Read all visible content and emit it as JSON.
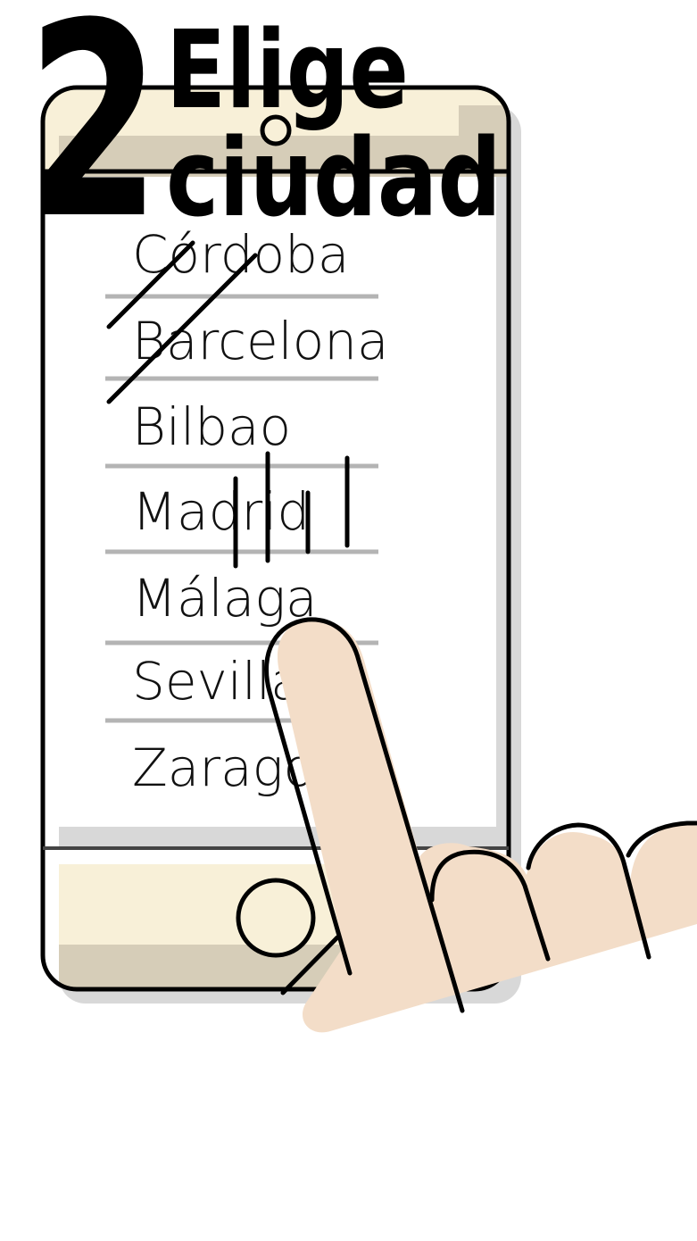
{
  "header": {
    "step_number": "2",
    "title_line1": "Elige",
    "title_line2": "ciudad"
  },
  "city_list": {
    "items": [
      {
        "label": "Córdoba"
      },
      {
        "label": "Barcelona"
      },
      {
        "label": "Bilbao"
      },
      {
        "label": "Madrid"
      },
      {
        "label": "Málaga"
      },
      {
        "label": "Sevilla"
      },
      {
        "label": "Zaragoza"
      }
    ]
  },
  "icons": {
    "phone": "smartphone-outline",
    "finger": "pointing-hand-icon",
    "home": "home-button-icon",
    "camera": "camera-icon"
  },
  "colors": {
    "phone_accent": "#f8f0d8",
    "phone_shadow": "#d6cdb8",
    "skin": "#f3ddc8",
    "divider": "#b4b4b4"
  }
}
